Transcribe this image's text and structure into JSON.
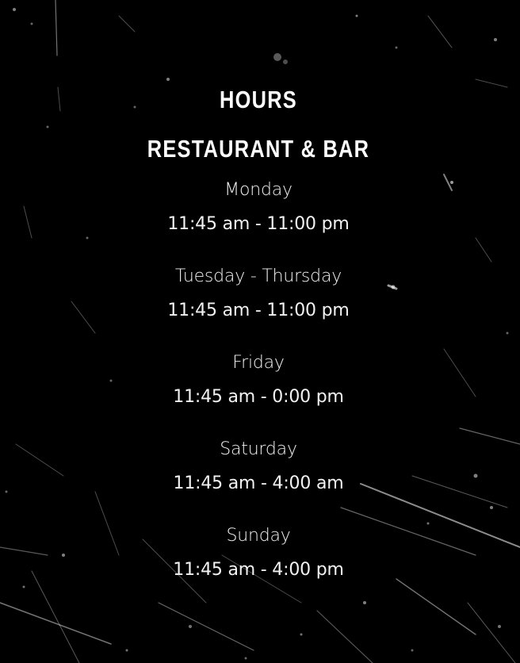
{
  "page": {
    "heading": "HOURS",
    "section_title": "RESTAURANT & BAR"
  },
  "hours": [
    {
      "day": "Monday",
      "time": "11:45 am - 11:00 pm"
    },
    {
      "day": "Tuesday - Thursday",
      "time": "11:45 am - 11:00 pm"
    },
    {
      "day": "Friday",
      "time": "11:45 am - 0:00 pm"
    },
    {
      "day": "Saturday",
      "time": "11:45 am - 4:00 am"
    },
    {
      "day": "Sunday",
      "time": "11:45 am - 4:00 pm"
    }
  ],
  "colors": {
    "background": "#000000",
    "text": "#ffffff",
    "texture": "#ffffff"
  }
}
